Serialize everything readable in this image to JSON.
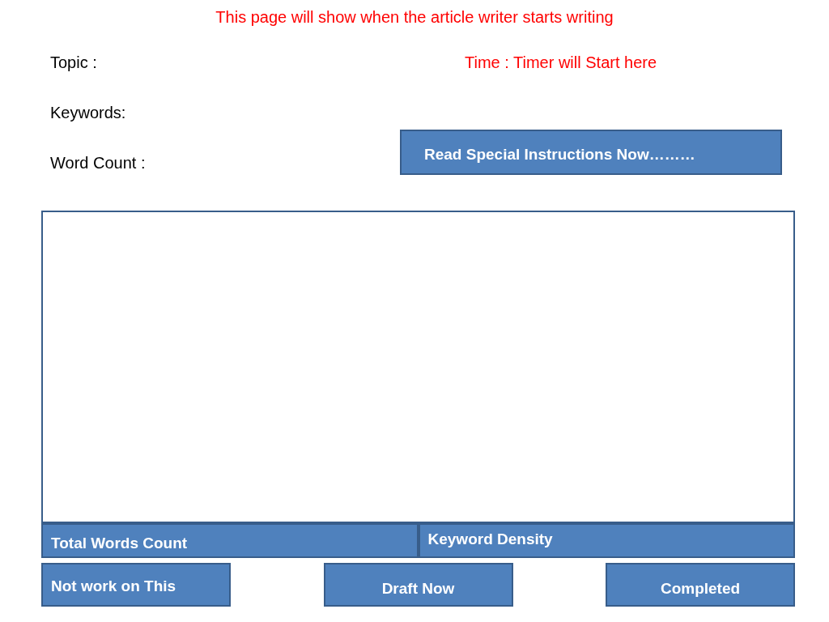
{
  "heading": "This page will show when the article writer starts writing",
  "fields": [
    {
      "label": "Topic :"
    },
    {
      "label": "Keywords:"
    },
    {
      "label": "Word Count :"
    }
  ],
  "timer": "Time : Timer will Start here",
  "instructions_button": "Read Special Instructions Now………",
  "stats": [
    {
      "label": "Total Words Count"
    },
    {
      "label": "Keyword Density"
    }
  ],
  "actions": [
    {
      "label": "Not work on This"
    },
    {
      "label": "Draft Now"
    },
    {
      "label": "Completed"
    }
  ]
}
